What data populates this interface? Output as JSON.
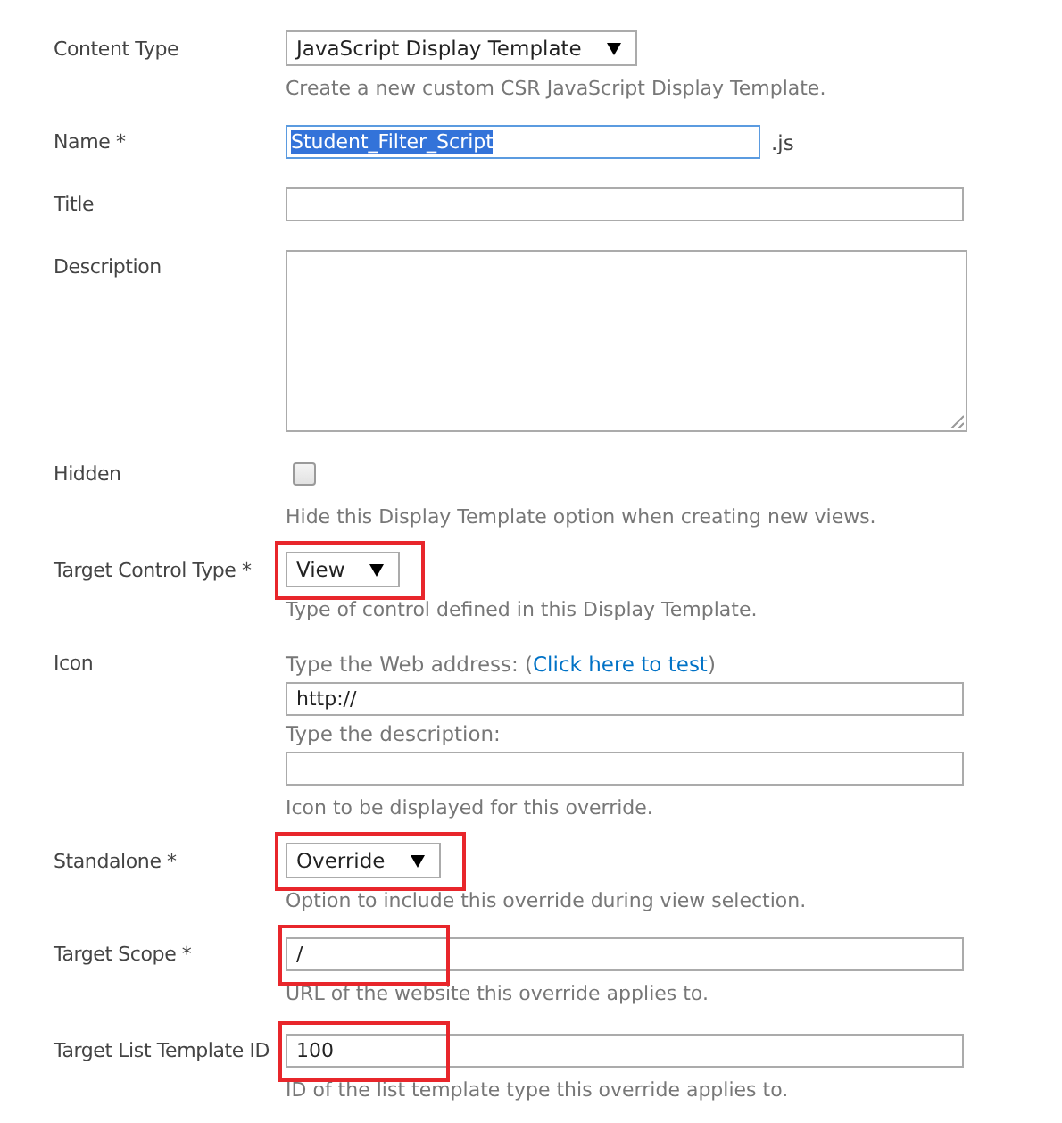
{
  "fields": [
    {
      "kind": "select",
      "label": "Content Type",
      "value": "JavaScript Display Template",
      "highlighted": false,
      "hint": "Create a new custom CSR JavaScript Display Template."
    },
    {
      "kind": "text",
      "label": "Name *",
      "value": "Student_Filter_Script",
      "focused": true,
      "suffix": ".js"
    },
    {
      "kind": "text",
      "label": "Title"
    },
    {
      "kind": "textarea",
      "label": "Description"
    },
    {
      "kind": "checkbox",
      "label": "Hidden",
      "checked": false,
      "hint": "Hide this Display Template option when creating new views."
    },
    {
      "kind": "select",
      "label": "Target Control Type *",
      "value": "View",
      "highlighted": true,
      "hint": "Type of control defined in this Display Template."
    },
    {
      "kind": "url",
      "label": "Icon",
      "prompt": "Type the Web address:",
      "link_open": "(",
      "link": "Click here to test",
      "link_close": ")",
      "url": "http://",
      "desc_prompt": "Type the description:",
      "hint": "Icon to be displayed for this override."
    },
    {
      "kind": "select",
      "label": "Standalone *",
      "value": "Override",
      "highlighted": true,
      "hint": "Option to include this override during view selection."
    },
    {
      "kind": "text",
      "label": "Target Scope *",
      "value": "/",
      "highlighted": true,
      "hint": "URL of the website this override applies to."
    },
    {
      "kind": "text",
      "label": "Target List Template ID",
      "value": "100",
      "highlighted": true,
      "hint": "ID of the list template type this override applies to."
    }
  ]
}
